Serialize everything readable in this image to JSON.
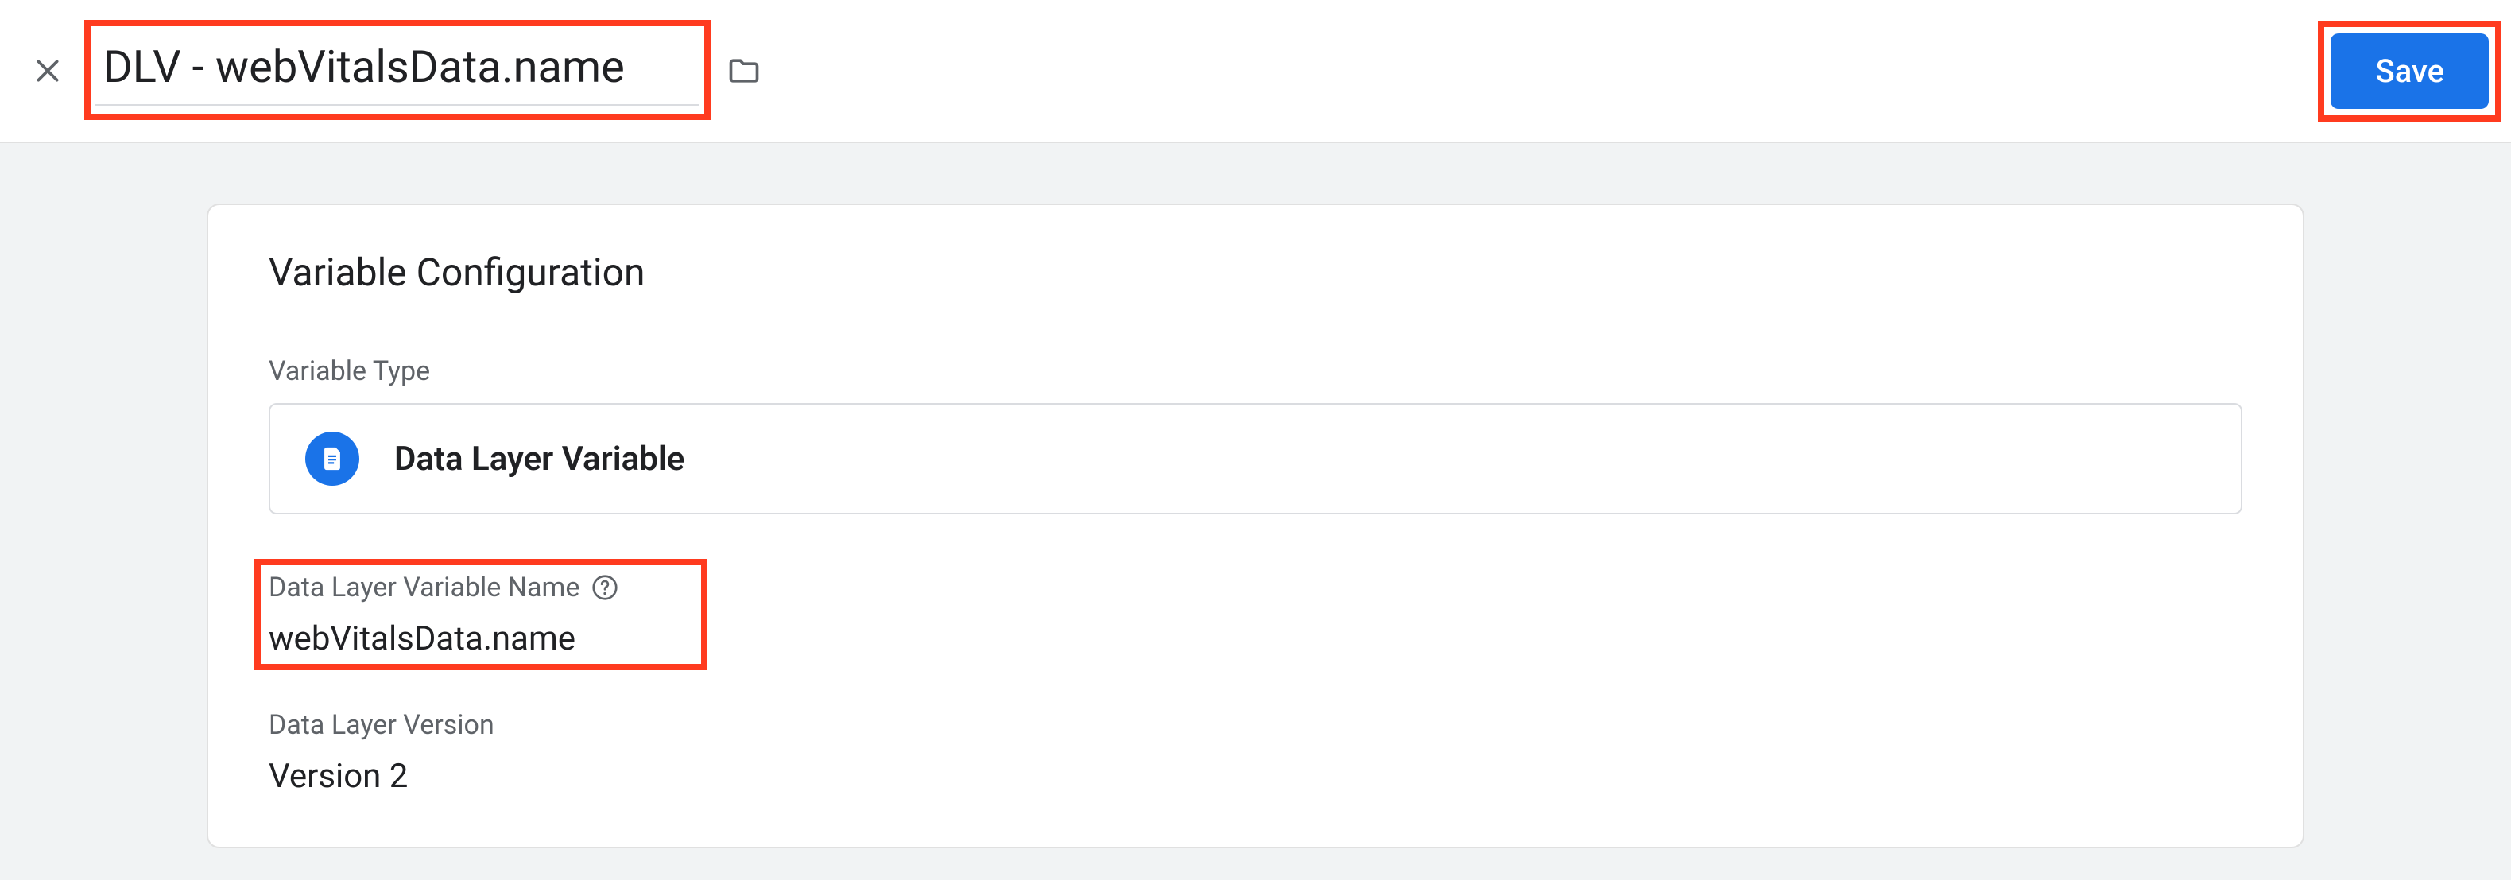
{
  "header": {
    "variable_name": "DLV - webVitalsData.name",
    "save_label": "Save"
  },
  "panel": {
    "title": "Variable Configuration",
    "type_section_label": "Variable Type",
    "type_name": "Data Layer Variable",
    "dlv_name_label": "Data Layer Variable Name",
    "dlv_name_value": "webVitalsData.name",
    "dlv_version_label": "Data Layer Version",
    "dlv_version_value": "Version 2"
  }
}
